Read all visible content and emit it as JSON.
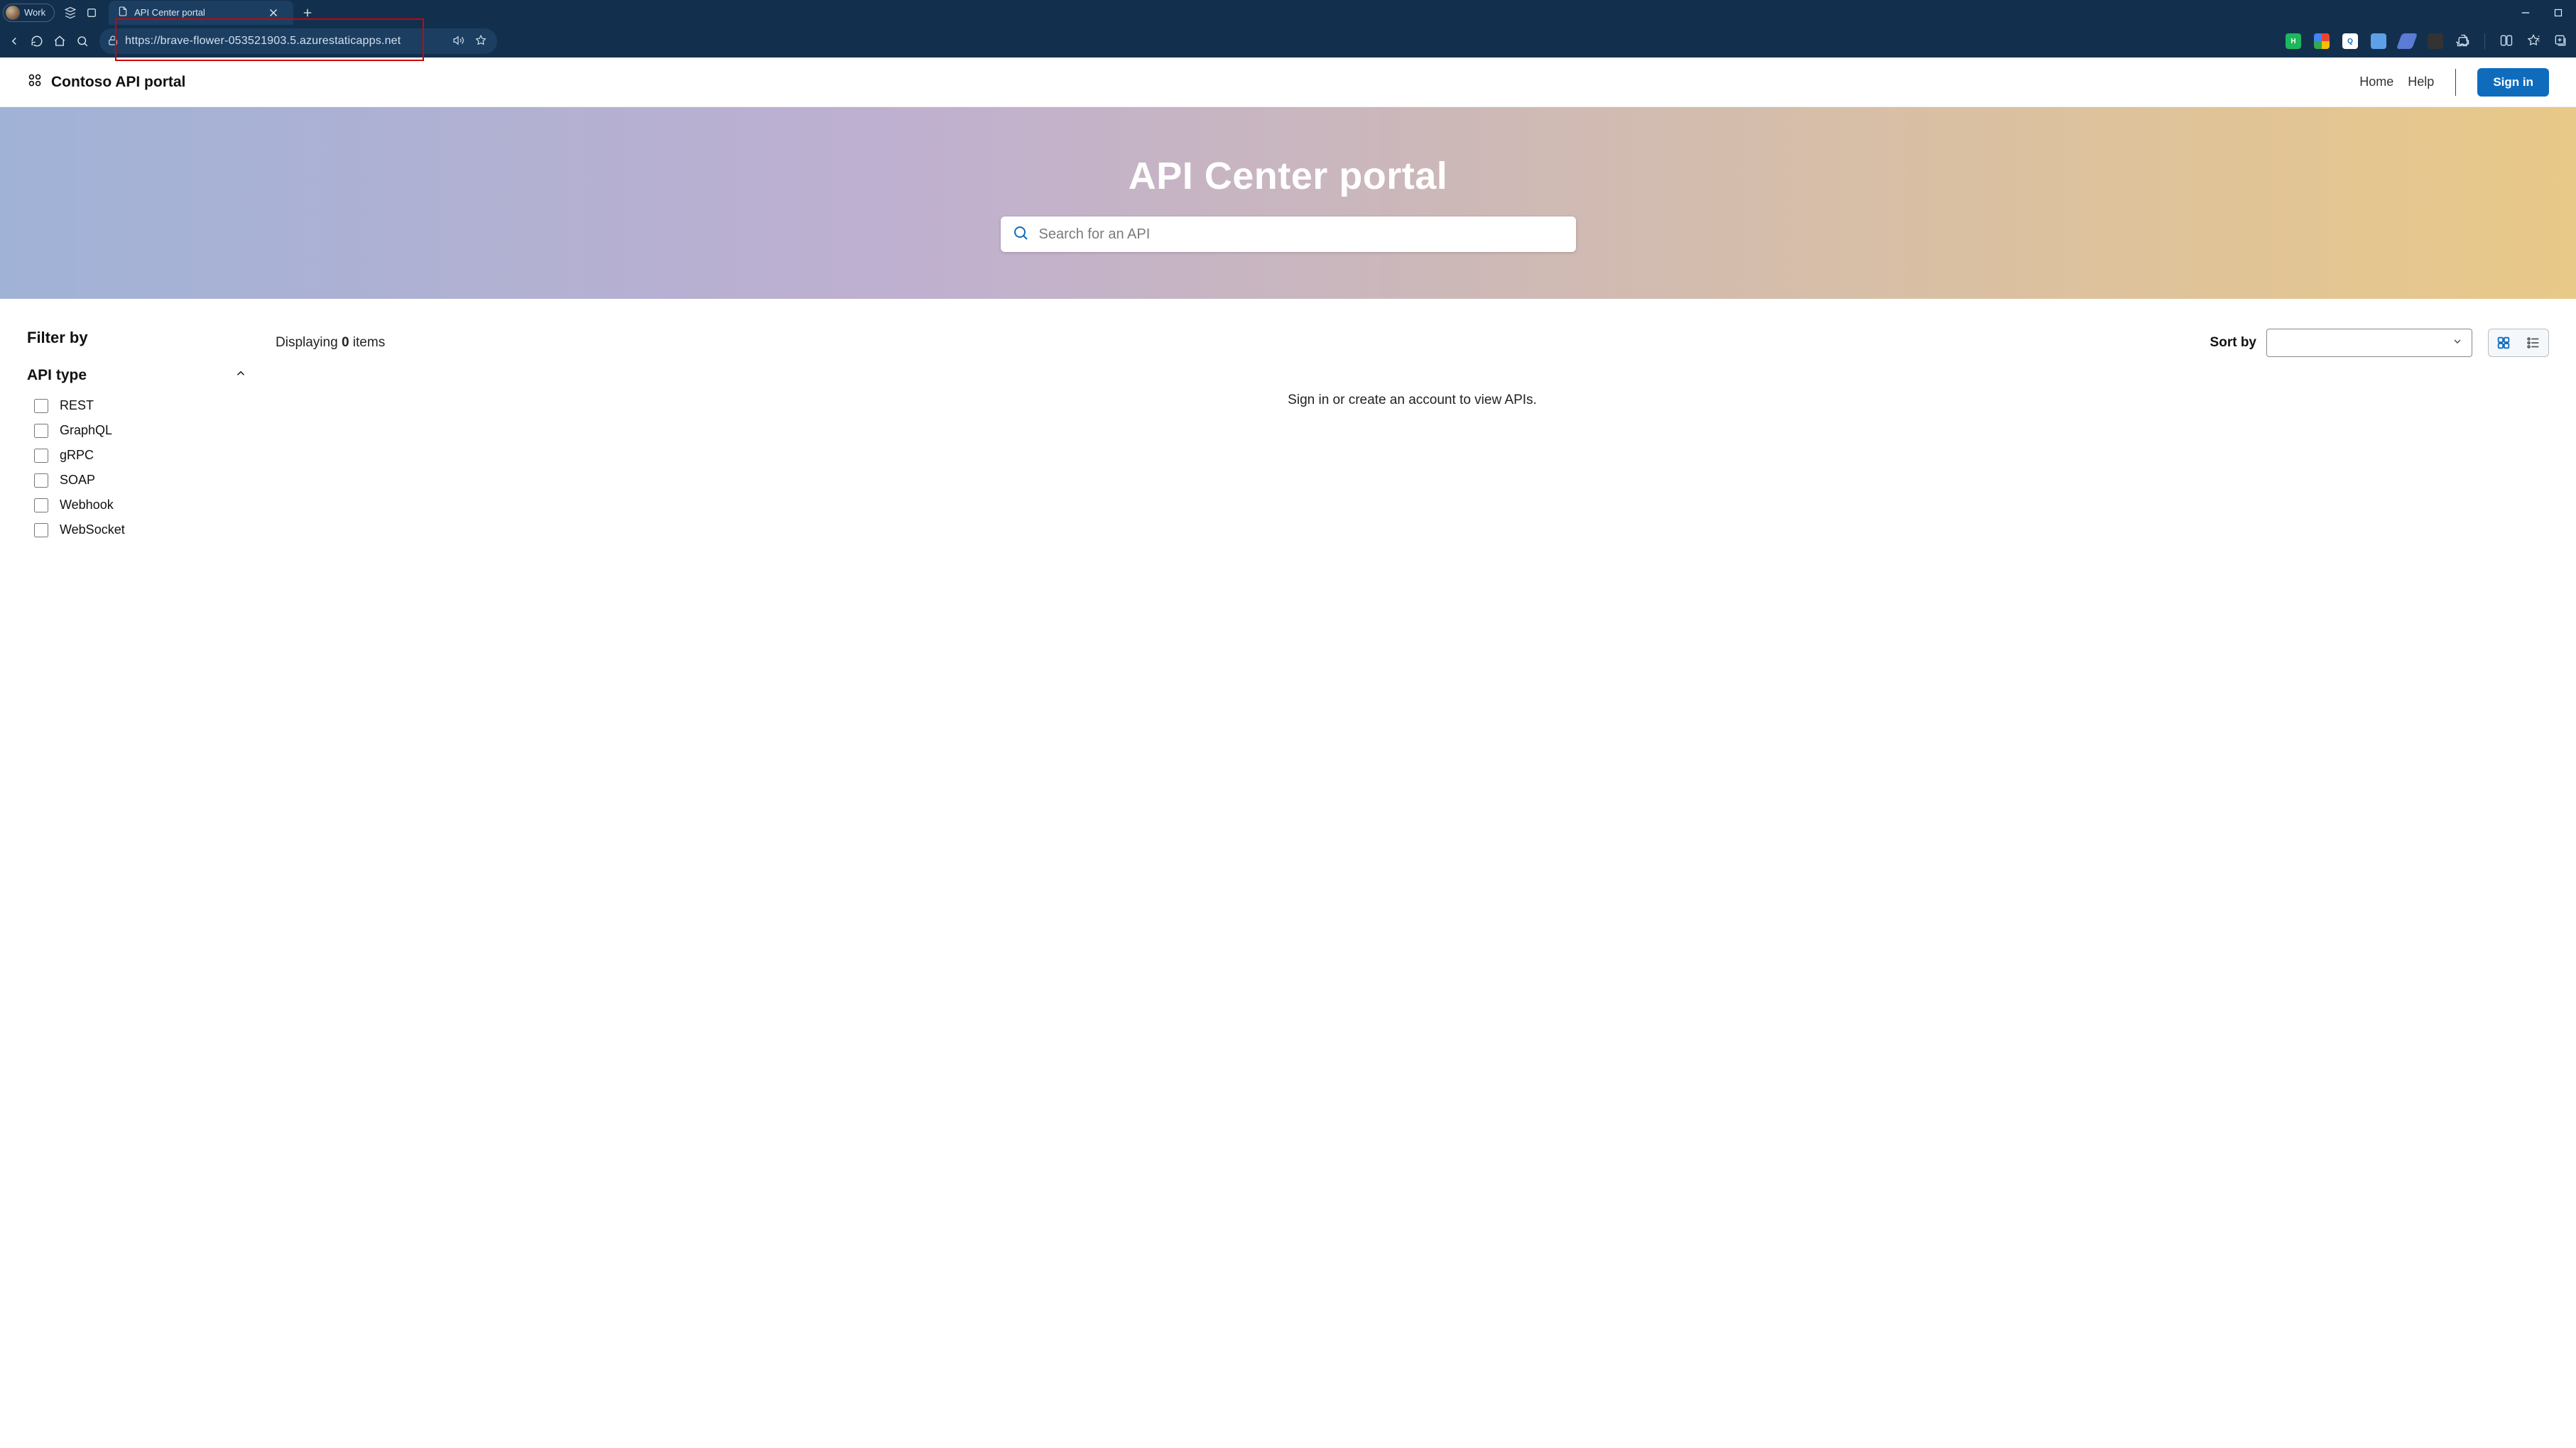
{
  "browser": {
    "profile_label": "Work",
    "tab_title": "API Center portal",
    "url": "https://brave-flower-053521903.5.azurestaticapps.net"
  },
  "header": {
    "brand": "Contoso API portal",
    "nav": {
      "home": "Home",
      "help": "Help",
      "signin": "Sign in"
    }
  },
  "hero": {
    "title": "API Center portal",
    "search_placeholder": "Search for an API"
  },
  "sidebar": {
    "filter_by": "Filter by",
    "group_title": "API type",
    "types": [
      "REST",
      "GraphQL",
      "gRPC",
      "SOAP",
      "Webhook",
      "WebSocket"
    ]
  },
  "main": {
    "displaying_prefix": "Displaying ",
    "displaying_count": "0",
    "displaying_suffix": " items",
    "sort_by": "Sort by",
    "empty_message": "Sign in or create an account to view APIs."
  }
}
